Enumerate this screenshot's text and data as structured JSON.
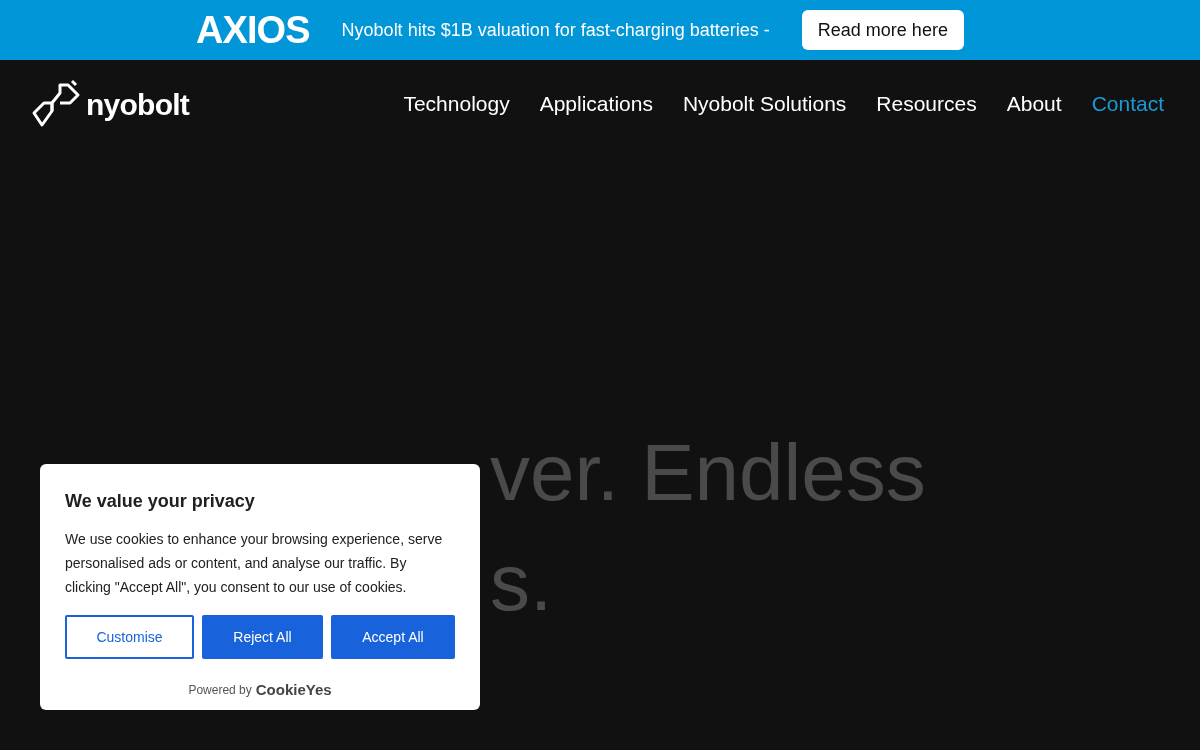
{
  "announcement": {
    "logo": "AXIOS",
    "text": "Nyobolt hits $1B valuation for fast-charging batteries -",
    "button": "Read more here"
  },
  "header": {
    "logo": "nyobolt",
    "nav": [
      {
        "label": "Technology",
        "selected": false
      },
      {
        "label": "Applications",
        "selected": false
      },
      {
        "label": "Nyobolt Solutions",
        "selected": false
      },
      {
        "label": "Resources",
        "selected": false
      },
      {
        "label": "About",
        "selected": false
      },
      {
        "label": "Contact",
        "selected": true
      }
    ]
  },
  "hero": {
    "lines": [
      "ver. Endless",
      "s."
    ]
  },
  "cookie_banner": {
    "title": "We value your privacy",
    "text": "We use cookies to enhance your browsing experience, serve personalised ads or content, and analyse our traffic. By clicking \"Accept All\", you consent to our use of cookies.",
    "buttons": [
      {
        "label": "Customise",
        "kind": "outline"
      },
      {
        "label": "Reject All",
        "kind": "solid"
      },
      {
        "label": "Accept All",
        "kind": "solid"
      }
    ],
    "powered_by": "Powered by",
    "brand": "CookieYes"
  }
}
